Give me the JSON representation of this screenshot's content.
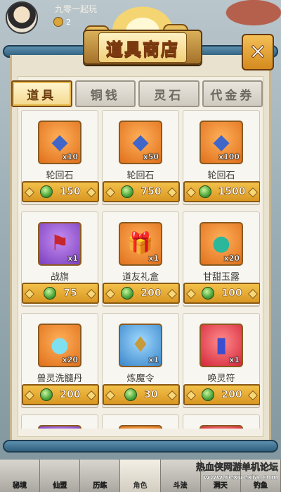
{
  "player": {
    "name": "九零一起玩",
    "coins": "2"
  },
  "shop": {
    "title": "道具商店",
    "close_label": "✕"
  },
  "tabs": [
    {
      "label": "道具",
      "active": true
    },
    {
      "label": "铜钱",
      "active": false
    },
    {
      "label": "灵石",
      "active": false
    },
    {
      "label": "代金券",
      "active": false
    }
  ],
  "items": [
    {
      "name": "轮回石",
      "qty": "x10",
      "price": "150",
      "icon": "blue-stone-icon",
      "glyph": "◆",
      "bg": "orange",
      "glyph_color": "#3f66c8"
    },
    {
      "name": "轮回石",
      "qty": "x50",
      "price": "750",
      "icon": "blue-stone-icon",
      "glyph": "◆",
      "bg": "orange",
      "glyph_color": "#3f66c8"
    },
    {
      "name": "轮回石",
      "qty": "x100",
      "price": "1500",
      "icon": "blue-stone-icon",
      "glyph": "◆",
      "bg": "orange",
      "glyph_color": "#3f66c8"
    },
    {
      "name": "战旗",
      "qty": "x1",
      "price": "75",
      "icon": "war-flag-icon",
      "glyph": "⚑",
      "bg": "purple",
      "glyph_color": "#c8262e"
    },
    {
      "name": "道友礼盒",
      "qty": "x1",
      "price": "200",
      "icon": "gift-box-icon",
      "glyph": "🎁",
      "bg": "orange",
      "glyph_color": "#d22"
    },
    {
      "name": "甘甜玉露",
      "qty": "x20",
      "price": "100",
      "icon": "jade-dew-icon",
      "glyph": "●",
      "bg": "orange",
      "glyph_color": "#2bb79a"
    },
    {
      "name": "兽灵洗髓丹",
      "qty": "x20",
      "price": "200",
      "icon": "beast-pill-icon",
      "glyph": "●",
      "bg": "orange",
      "glyph_color": "#7fe0f0"
    },
    {
      "name": "炼魔令",
      "qty": "x1",
      "price": "30",
      "icon": "demon-token-icon",
      "glyph": "♦",
      "bg": "blue",
      "glyph_color": "#c79a3a"
    },
    {
      "name": "唤灵符",
      "qty": "x1",
      "price": "200",
      "icon": "summon-talisman-icon",
      "glyph": "▮",
      "bg": "red",
      "glyph_color": "#3a4fd0"
    },
    {
      "name": "",
      "qty": "",
      "price": "",
      "icon": "item-icon",
      "glyph": "",
      "bg": "purple",
      "glyph_color": "#fff"
    },
    {
      "name": "",
      "qty": "",
      "price": "",
      "icon": "item-icon",
      "glyph": "",
      "bg": "orange",
      "glyph_color": "#fff"
    },
    {
      "name": "",
      "qty": "",
      "price": "",
      "icon": "item-icon",
      "glyph": "",
      "bg": "red",
      "glyph_color": "#fff"
    }
  ],
  "bottom_nav": [
    {
      "label": "秘境",
      "active": false
    },
    {
      "label": "仙盟",
      "active": false
    },
    {
      "label": "历练",
      "active": false
    },
    {
      "label": "角色",
      "active": true
    },
    {
      "label": "斗法",
      "active": false
    },
    {
      "label": "洞天",
      "active": false
    },
    {
      "label": "钓鱼",
      "active": false
    }
  ],
  "watermark": {
    "line1": "热血侠网游单机论坛",
    "line2": "www.rexuexia.com"
  }
}
